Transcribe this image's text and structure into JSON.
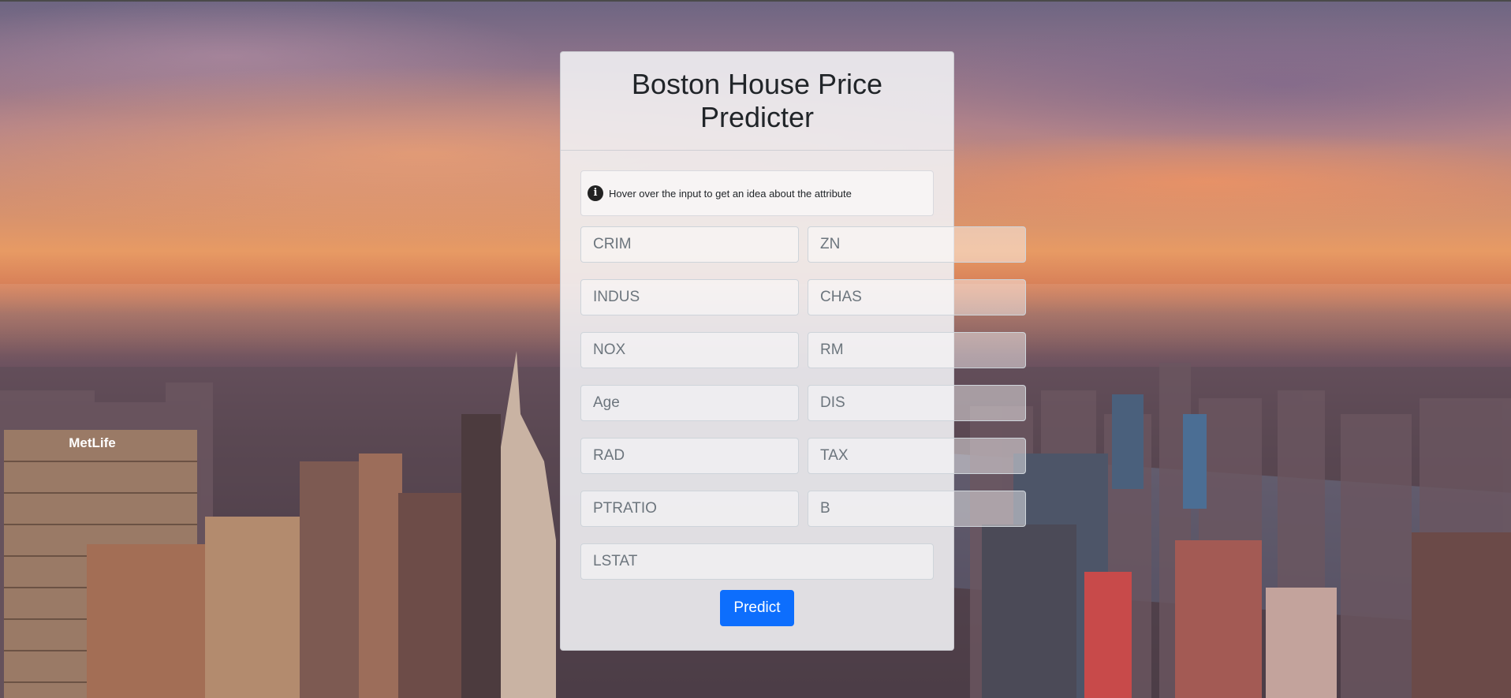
{
  "card": {
    "title": "Boston House Price Predicter",
    "info": {
      "icon": "info-icon",
      "text": "Hover over the input to get an idea about the attribute"
    },
    "fields": [
      {
        "name": "crim",
        "placeholder": "CRIM"
      },
      {
        "name": "zn",
        "placeholder": "ZN"
      },
      {
        "name": "indus",
        "placeholder": "INDUS"
      },
      {
        "name": "chas",
        "placeholder": "CHAS"
      },
      {
        "name": "nox",
        "placeholder": "NOX"
      },
      {
        "name": "rm",
        "placeholder": "RM"
      },
      {
        "name": "age",
        "placeholder": "Age"
      },
      {
        "name": "dis",
        "placeholder": "DIS"
      },
      {
        "name": "rad",
        "placeholder": "RAD"
      },
      {
        "name": "tax",
        "placeholder": "TAX"
      },
      {
        "name": "ptratio",
        "placeholder": "PTRATIO"
      },
      {
        "name": "b",
        "placeholder": "B"
      },
      {
        "name": "lstat",
        "placeholder": "LSTAT"
      }
    ],
    "submit_label": "Predict"
  },
  "background": {
    "building_sign": "MetLife"
  },
  "colors": {
    "button": "#0d6efd",
    "card": "#f0f0f3"
  }
}
